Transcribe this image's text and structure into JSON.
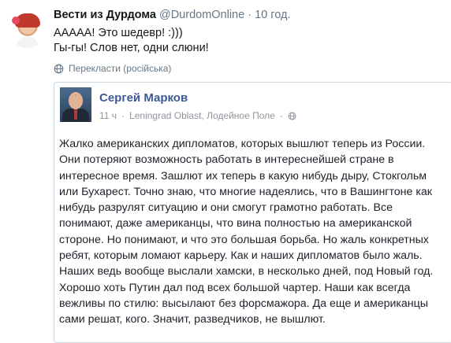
{
  "tweet": {
    "display_name": "Вести из Дурдома",
    "screen_name": "@DurdomOnline",
    "separator": "·",
    "time": "10 год.",
    "text_lines": [
      "ААААА! Это шедевр! :)))",
      "Гы-гы! Слов нет, одни слюни!"
    ],
    "translate_label": "Перекласти (російська)"
  },
  "quoted_post": {
    "author_name": "Сергей Марков",
    "time": "11 ч",
    "separator": "·",
    "location": "Leningrad Oblast, Лодейное Поле",
    "separator_2": "·",
    "text_lines": [
      "Жалко американских дипломатов, которых вышлют теперь из России.",
      "Они потеряют возможность работать в интереснейшей стране в",
      "интересное время. Зашлют их теперь в какую нибудь дыру, Стокгольм",
      "или Бухарест. Точно знаю, что многие надеялись, что в Вашингтоне как",
      "нибудь разрулят ситуацию и они смогут грамотно работать. Все",
      "понимают, даже американцы, что вина полностью на американской",
      "стороне. Но понимают, и что это большая борьба. Но жаль конкретных",
      "ребят, которым ломают карьеру. Как и наших дипломатов было жаль.",
      "Наших ведь вообще выслали хамски, в несколько дней, под Новый год.",
      "Хорошо хоть Путин дал под всех большой чартер. Наши как всегда",
      "вежливы по стилю: высылают без форсмажора. Да еще и американцы",
      "сами решат, кого. Значит, разведчиков, не вышлют."
    ]
  },
  "icons": {
    "translate": "globe-icon",
    "privacy": "globe-icon"
  },
  "colors": {
    "link": "#3b5998",
    "muted": "#657786",
    "border": "#ccd6dd"
  }
}
